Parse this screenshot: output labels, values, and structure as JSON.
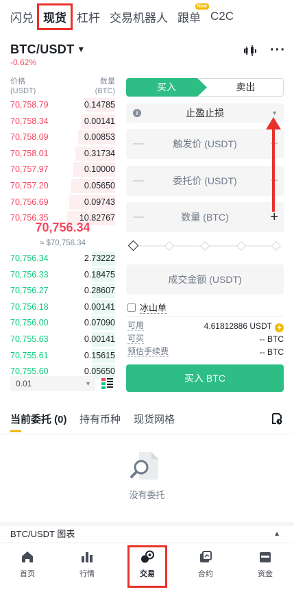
{
  "top_tabs": [
    {
      "label": "闪兑"
    },
    {
      "label": "现货"
    },
    {
      "label": "杠杆"
    },
    {
      "label": "交易机器人"
    },
    {
      "label": "跟单",
      "badge": "New"
    },
    {
      "label": "C2C"
    }
  ],
  "pair": {
    "name": "BTC/USDT",
    "change": "-0.62%"
  },
  "orderbook": {
    "price_header": "价格\n(USDT)",
    "qty_header": "数量\n(BTC)",
    "asks": [
      {
        "price": "70,758.79",
        "qty": "0.14785",
        "depth": 0.28
      },
      {
        "price": "70,758.34",
        "qty": "0.00141",
        "depth": 0.32
      },
      {
        "price": "70,758.09",
        "qty": "0.00853",
        "depth": 0.35
      },
      {
        "price": "70,758.01",
        "qty": "0.31734",
        "depth": 0.38
      },
      {
        "price": "70,757.97",
        "qty": "0.10000",
        "depth": 0.4
      },
      {
        "price": "70,757.20",
        "qty": "0.05650",
        "depth": 0.42
      },
      {
        "price": "70,756.69",
        "qty": "0.09743",
        "depth": 0.44
      },
      {
        "price": "70,756.35",
        "qty": "10.82767",
        "depth": 0.46
      }
    ],
    "last_price": "70,756.34",
    "approx": "≈ $70,756.34",
    "bids": [
      {
        "price": "70,756.34",
        "qty": "2.73222",
        "depth": 0.22
      },
      {
        "price": "70,756.33",
        "qty": "0.18475",
        "depth": 0.22
      },
      {
        "price": "70,756.27",
        "qty": "0.28607",
        "depth": 0.22
      },
      {
        "price": "70,756.18",
        "qty": "0.00141",
        "depth": 0.22
      },
      {
        "price": "70,756.00",
        "qty": "0.07090",
        "depth": 0.22
      },
      {
        "price": "70,755.63",
        "qty": "0.00141",
        "depth": 0.22
      },
      {
        "price": "70,755.61",
        "qty": "0.15615",
        "depth": 0.22
      },
      {
        "price": "70,755.60",
        "qty": "0.05650",
        "depth": 0.22
      }
    ],
    "depth_select": "0.01"
  },
  "trade": {
    "buy_label": "买入",
    "sell_label": "卖出",
    "order_type": "止盈止损",
    "trigger_placeholder": "触发价 (USDT)",
    "limit_placeholder": "委托价 (USDT)",
    "amount_placeholder": "数量 (BTC)",
    "total_placeholder": "成交金额 (USDT)",
    "iceberg_label": "冰山单",
    "available_label": "可用",
    "available_value": "4.61812886 USDT",
    "max_buy_label": "可买",
    "max_buy_value": "-- BTC",
    "fee_label": "预估手续费",
    "fee_value": "-- BTC",
    "buy_button": "买入 BTC"
  },
  "orders": {
    "tabs": [
      "当前委托 (0)",
      "持有币种",
      "现货网格"
    ],
    "empty_text": "没有委托"
  },
  "chart_bar": {
    "label": "BTC/USDT 图表"
  },
  "bottom_nav": [
    {
      "label": "首页",
      "icon": "home-icon"
    },
    {
      "label": "行情",
      "icon": "markets-icon"
    },
    {
      "label": "交易",
      "icon": "trade-icon"
    },
    {
      "label": "合约",
      "icon": "futures-icon"
    },
    {
      "label": "资金",
      "icon": "wallet-icon"
    }
  ],
  "colors": {
    "buy": "#2ebd85",
    "sell": "#f6465d",
    "accent": "#f0b90b",
    "highlight": "#e8312a"
  }
}
